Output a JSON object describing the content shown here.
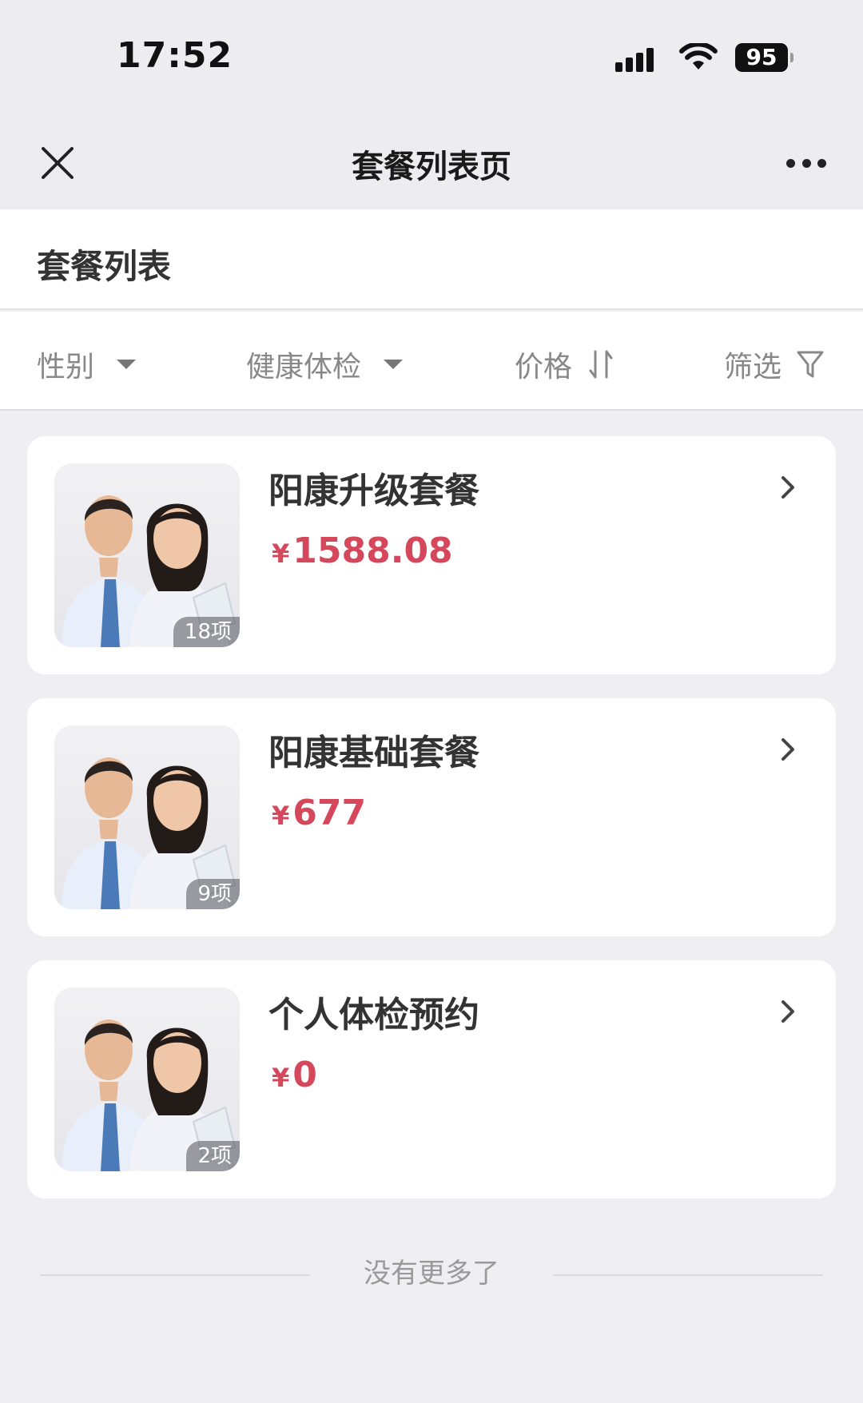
{
  "status_bar": {
    "time": "17:52",
    "battery": "95"
  },
  "navbar": {
    "title": "套餐列表页",
    "close_icon": "close-icon",
    "more_icon": "more-dots-icon"
  },
  "section": {
    "title": "套餐列表"
  },
  "filters": [
    {
      "label": "性别",
      "icon": "caret-down-icon"
    },
    {
      "label": "健康体检",
      "icon": "caret-down-icon"
    },
    {
      "label": "价格",
      "icon": "sort-icon"
    },
    {
      "label": "筛选",
      "icon": "filter-icon"
    }
  ],
  "packages": [
    {
      "title": "阳康升级套餐",
      "currency": "¥",
      "price": "1588.08",
      "count": "18项"
    },
    {
      "title": "阳康基础套餐",
      "currency": "¥",
      "price": "677",
      "count": "9项"
    },
    {
      "title": "个人体检预约",
      "currency": "¥",
      "price": "0",
      "count": "2项"
    }
  ],
  "footer": {
    "end_text": "没有更多了"
  },
  "colors": {
    "price": "#d5485b",
    "page_bg": "#efeff3"
  }
}
